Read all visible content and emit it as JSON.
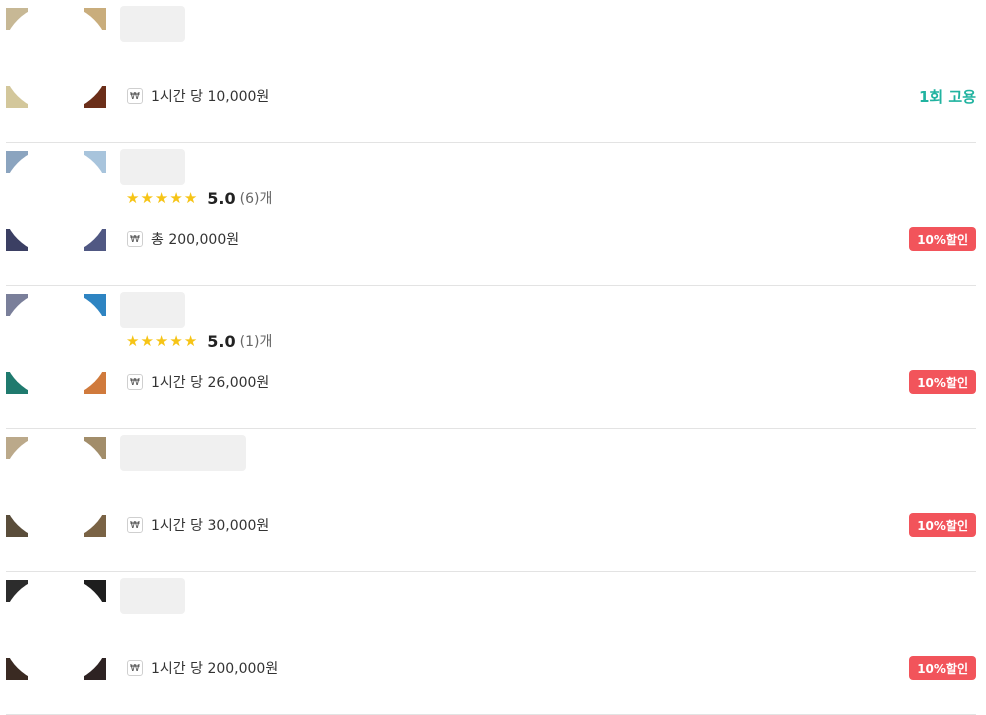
{
  "listings": [
    {
      "colors": [
        "#c7b895",
        "#c9ad7c",
        "#d3c79b",
        "#6b2e19"
      ],
      "name_width": 65,
      "rating": null,
      "price": "1시간 당 10,000원",
      "tag": {
        "type": "hire",
        "label": "1회 고용"
      }
    },
    {
      "colors": [
        "#8ba4bf",
        "#a8c4dc",
        "#3b3f63",
        "#505883"
      ],
      "name_width": 65,
      "rating": {
        "score": "5.0",
        "count": "(6)개"
      },
      "price": "총 200,000원",
      "tag": {
        "type": "discount",
        "label": "10%할인"
      }
    },
    {
      "colors": [
        "#7a7f9a",
        "#2e84c2",
        "#1f7a6e",
        "#d07a3c"
      ],
      "name_width": 65,
      "rating": {
        "score": "5.0",
        "count": "(1)개"
      },
      "price": "1시간 당 26,000원",
      "tag": {
        "type": "discount",
        "label": "10%할인"
      }
    },
    {
      "colors": [
        "#bba98a",
        "#a28d6a",
        "#5a4d3a",
        "#7a6345"
      ],
      "name_width": 126,
      "rating": null,
      "price": "1시간 당 30,000원",
      "tag": {
        "type": "discount",
        "label": "10%할인"
      }
    },
    {
      "colors": [
        "#2c2c2c",
        "#1e1e1e",
        "#3a2a22",
        "#2e2323"
      ],
      "name_width": 65,
      "rating": null,
      "price": "1시간 당 200,000원",
      "tag": {
        "type": "discount",
        "label": "10%할인"
      }
    }
  ],
  "icons": {
    "won": "₩",
    "star": "★"
  }
}
